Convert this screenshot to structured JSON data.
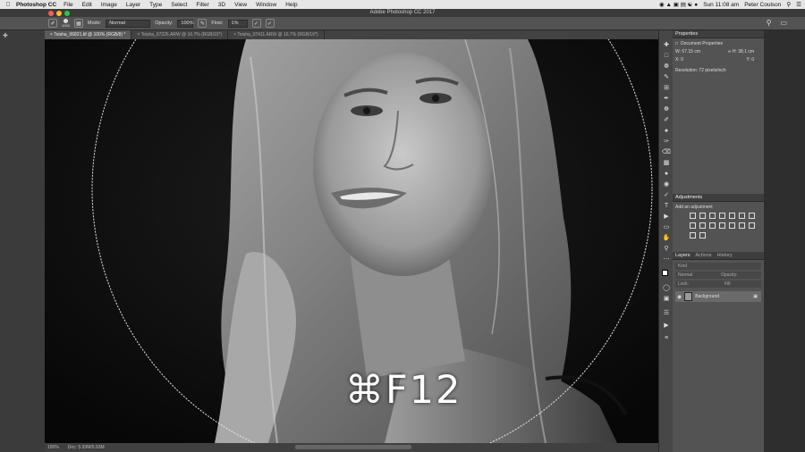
{
  "menubar": {
    "app_name": "Photoshop CC",
    "items": [
      "File",
      "Edit",
      "Image",
      "Layer",
      "Type",
      "Select",
      "Filter",
      "3D",
      "View",
      "Window",
      "Help"
    ],
    "clock": "Sun 11:08 am",
    "user": "Peter Coulson"
  },
  "window": {
    "title": "Adobe Photoshop CC 2017"
  },
  "options": {
    "mode_label": "Mode:",
    "mode_value": "Normal",
    "opacity_label": "Opacity:",
    "opacity_value": "100%",
    "flow_label": "Flow:",
    "flow_value": "1%",
    "brush_size": "1000"
  },
  "tabs": [
    "× Teisha_06821.tif @ 100% (RGB/8) *",
    "× Teisha_07226.ARW @ 16.7% (RGB/16*)",
    "× Teisha_07411.ARW @ 16.7% (RGB/16*)"
  ],
  "status": {
    "zoom": "100%",
    "doc": "Doc: 5.93M/5.93M"
  },
  "overlay": {
    "shortcut": "⌘F12"
  },
  "properties": {
    "header": "Properties",
    "section": "Document Properties",
    "w_label": "W:",
    "w_value": "57.15 cm",
    "h_label": "H:",
    "h_value": "38.1 cm",
    "x_label": "X:",
    "x_value": "0",
    "y_label": "Y:",
    "y_value": "0",
    "resolution": "Resolution: 72 pixels/inch"
  },
  "adjustments": {
    "header": "Adjustments",
    "subtitle": "Add an adjustment"
  },
  "layers": {
    "tabs": [
      "Layers",
      "Actions",
      "History"
    ],
    "filter_placeholder": "Kind",
    "blend_mode": "Normal",
    "opacity": "Opacity:",
    "lock_label": "Lock:",
    "fill_label": "Fill:",
    "layer_name": "Background"
  },
  "colors": {
    "accent": "#535353",
    "canvas_bg": "#0b0b0b",
    "menubar": "#e6e6e6"
  }
}
